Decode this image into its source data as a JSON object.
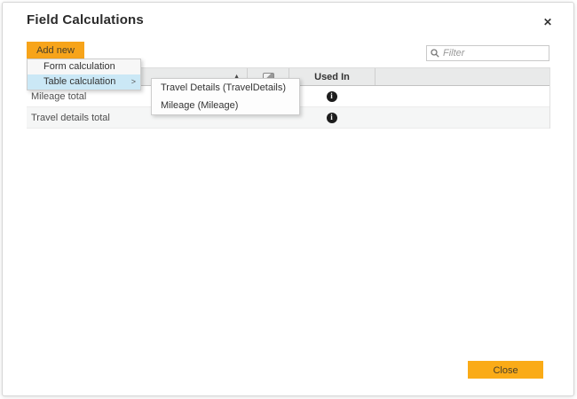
{
  "dialog": {
    "title": "Field Calculations",
    "close_icon": "✕"
  },
  "toolbar": {
    "add_new_label": "Add new",
    "filter_placeholder": "Filter"
  },
  "menu": {
    "items": [
      {
        "label": "Form calculation"
      },
      {
        "label": "Table calculation",
        "highlighted": true,
        "arrow": ">"
      }
    ]
  },
  "submenu": {
    "items": [
      {
        "label": "Travel Details (TravelDetails)"
      },
      {
        "label": "Mileage (Mileage)"
      }
    ]
  },
  "table": {
    "header": {
      "sort_indicator": "▲",
      "comment_icon": "comment-icon",
      "used_in_label": "Used In"
    },
    "rows": [
      {
        "name": "Mileage total",
        "info": "i"
      },
      {
        "name": "Travel details total",
        "info": "i"
      }
    ]
  },
  "footer": {
    "close_label": "Close"
  },
  "colors": {
    "accent_orange": "#f7a41a",
    "menu_highlight": "#cbe8f6",
    "header_bg": "#e9eaea",
    "row_alt_bg": "#f5f6f6",
    "info_icon_bg": "#1d1d1d"
  }
}
